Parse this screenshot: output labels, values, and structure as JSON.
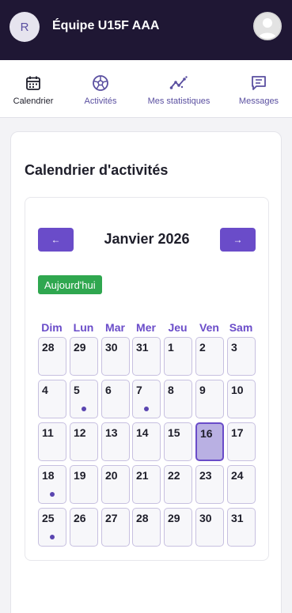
{
  "header": {
    "avatar_initial": "R",
    "team_name": "Équipe U15F AAA"
  },
  "tabs": [
    {
      "label": "Calendrier",
      "icon": "calendar-icon",
      "active": true
    },
    {
      "label": "Activités",
      "icon": "soccer-ball-icon",
      "active": false
    },
    {
      "label": "Mes statistiques",
      "icon": "trend-chart-icon",
      "active": false
    },
    {
      "label": "Messages",
      "icon": "message-icon",
      "active": false
    }
  ],
  "calendar": {
    "title": "Calendrier d'activités",
    "month_label": "Janvier 2026",
    "prev_label": "←",
    "next_label": "→",
    "today_label": "Aujourd'hui",
    "weekdays": [
      "Dim",
      "Lun",
      "Mar",
      "Mer",
      "Jeu",
      "Ven",
      "Sam"
    ],
    "weeks": [
      [
        {
          "d": "28"
        },
        {
          "d": "29"
        },
        {
          "d": "30"
        },
        {
          "d": "31"
        },
        {
          "d": "1"
        },
        {
          "d": "2"
        },
        {
          "d": "3"
        }
      ],
      [
        {
          "d": "4"
        },
        {
          "d": "5",
          "event": true
        },
        {
          "d": "6"
        },
        {
          "d": "7",
          "event": true
        },
        {
          "d": "8"
        },
        {
          "d": "9"
        },
        {
          "d": "10"
        }
      ],
      [
        {
          "d": "11"
        },
        {
          "d": "12"
        },
        {
          "d": "13"
        },
        {
          "d": "14"
        },
        {
          "d": "15"
        },
        {
          "d": "16",
          "today": true
        },
        {
          "d": "17"
        }
      ],
      [
        {
          "d": "18",
          "event": true
        },
        {
          "d": "19"
        },
        {
          "d": "20"
        },
        {
          "d": "21"
        },
        {
          "d": "22"
        },
        {
          "d": "23"
        },
        {
          "d": "24"
        }
      ],
      [
        {
          "d": "25",
          "event": true
        },
        {
          "d": "26"
        },
        {
          "d": "27"
        },
        {
          "d": "28"
        },
        {
          "d": "29"
        },
        {
          "d": "30"
        },
        {
          "d": "31"
        }
      ]
    ]
  },
  "colors": {
    "accent": "#6a4cc9",
    "header_bg": "#1f1734",
    "today_button": "#2fa74f"
  }
}
